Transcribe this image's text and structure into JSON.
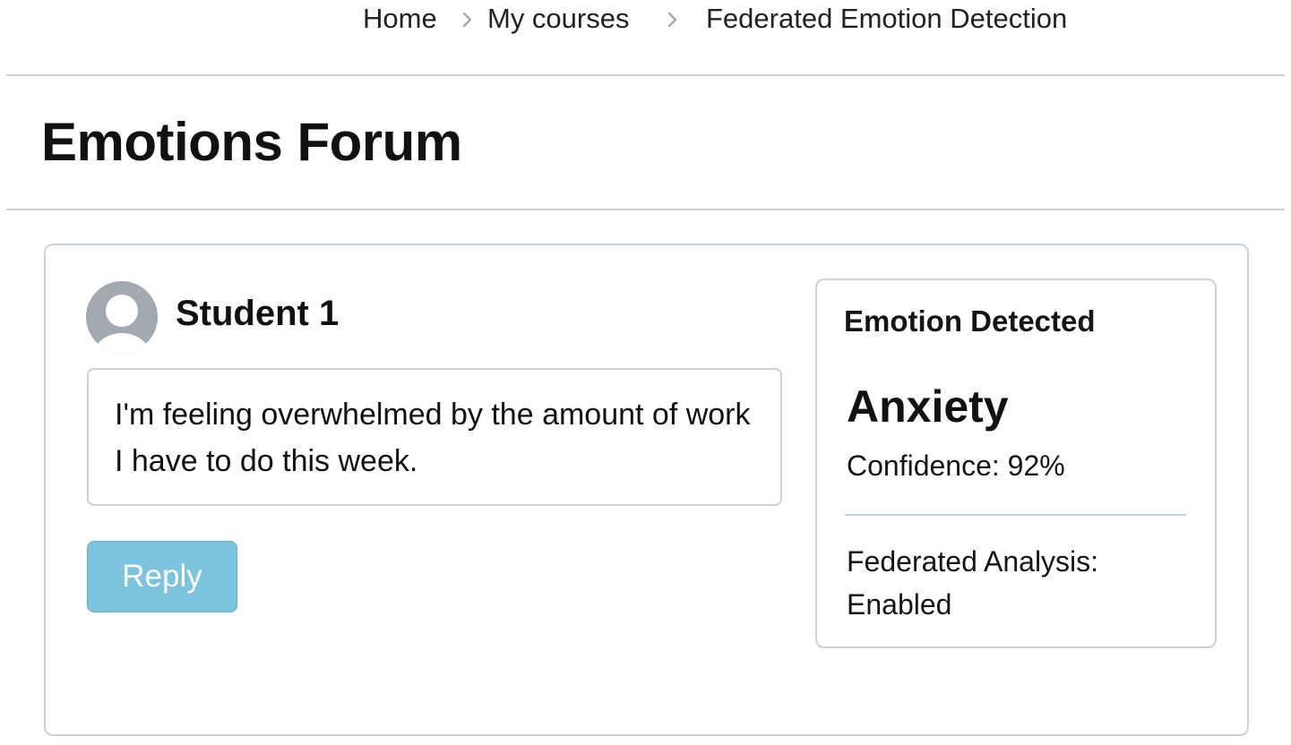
{
  "breadcrumb": {
    "items": [
      "Home",
      "My courses",
      "Federated Emotion Detection"
    ]
  },
  "page": {
    "title": "Emotions Forum"
  },
  "post": {
    "author": "Student 1",
    "avatar_icon": "user-avatar-icon",
    "message": "I'm feeling overwhelmed by the amount of work I have to do this week.",
    "reply_label": "Reply"
  },
  "emotion_panel": {
    "heading": "Emotion Detected",
    "emotion": "Anxiety",
    "confidence_label": "Confidence: 92%",
    "confidence_value": 0.92,
    "federated_label": "Federated Analysis:",
    "federated_value": "Enabled"
  },
  "colors": {
    "reply_button": "#7cc3dd",
    "border": "#c9d3dc",
    "avatar": "#a3a9b0"
  }
}
